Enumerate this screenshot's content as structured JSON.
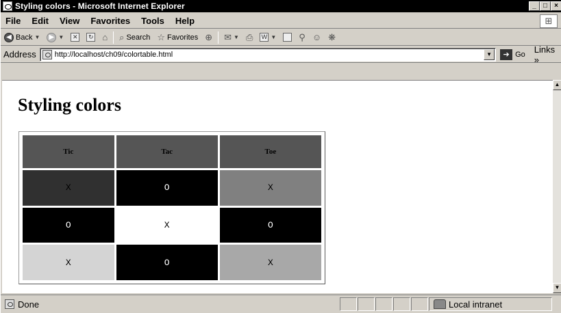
{
  "window": {
    "title": "Styling colors - Microsoft Internet Explorer",
    "controls": {
      "minimize": "_",
      "maximize": "□",
      "close": "×"
    }
  },
  "menu": [
    "File",
    "Edit",
    "View",
    "Favorites",
    "Tools",
    "Help"
  ],
  "toolbar": {
    "back_label": "Back",
    "search_label": "Search",
    "favorites_label": "Favorites"
  },
  "address": {
    "label": "Address",
    "url": "http://localhost/ch09/colortable.html",
    "go_label": "Go",
    "links_label": "Links »"
  },
  "page": {
    "heading": "Styling colors",
    "table": {
      "headers": [
        "Tic",
        "Tac",
        "Toe"
      ],
      "rows": [
        [
          "X",
          "O",
          "X"
        ],
        [
          "O",
          "X",
          "O"
        ],
        [
          "X",
          "O",
          "X"
        ]
      ],
      "header_bg": "#555555",
      "cell_colors": [
        [
          {
            "bg": "#303030",
            "fg": "#000000"
          },
          {
            "bg": "#000000",
            "fg": "#ffffff"
          },
          {
            "bg": "#808080",
            "fg": "#000000"
          }
        ],
        [
          {
            "bg": "#000000",
            "fg": "#ffffff"
          },
          {
            "bg": "#ffffff",
            "fg": "#000000"
          },
          {
            "bg": "#000000",
            "fg": "#ffffff"
          }
        ],
        [
          {
            "bg": "#d4d4d4",
            "fg": "#000000"
          },
          {
            "bg": "#000000",
            "fg": "#ffffff"
          },
          {
            "bg": "#a8a8a8",
            "fg": "#000000"
          }
        ]
      ]
    }
  },
  "status": {
    "text": "Done",
    "zone": "Local intranet"
  }
}
